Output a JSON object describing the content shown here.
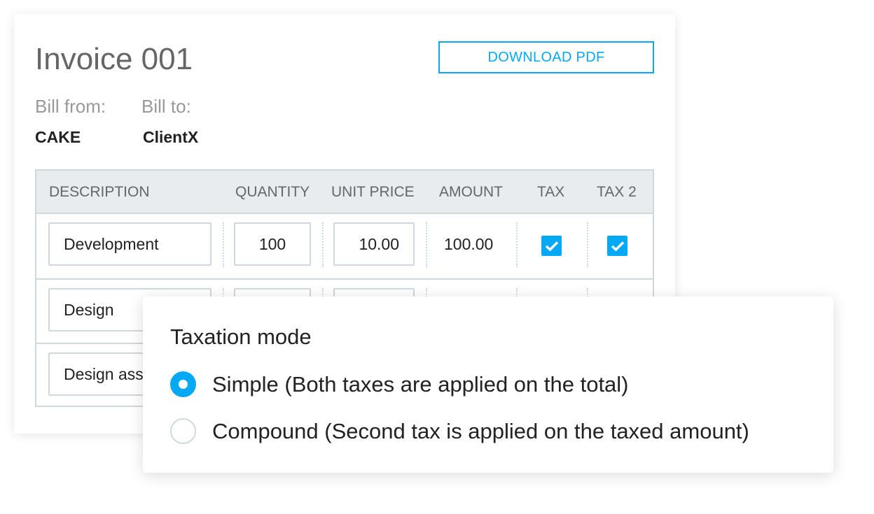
{
  "invoice": {
    "title": "Invoice 001",
    "download_label": "DOWNLOAD PDF",
    "bill_from_label": "Bill from:",
    "bill_from_value": "CAKE",
    "bill_to_label": "Bill to:",
    "bill_to_value": "ClientX"
  },
  "table": {
    "headers": [
      "DESCRIPTION",
      "QUANTITY",
      "UNIT PRICE",
      "AMOUNT",
      "TAX",
      "TAX 2"
    ],
    "rows": [
      {
        "description": "Development",
        "quantity": "100",
        "unit_price": "10.00",
        "amount": "100.00",
        "tax": true,
        "tax2": true
      },
      {
        "description": "Design",
        "quantity": "",
        "unit_price": "",
        "amount": "",
        "tax": null,
        "tax2": null
      },
      {
        "description": "Design ass",
        "quantity": "",
        "unit_price": "",
        "amount": "",
        "tax": null,
        "tax2": null
      }
    ]
  },
  "taxation_popup": {
    "title": "Taxation mode",
    "options": [
      {
        "label": "Simple (Both taxes are applied on the total)",
        "selected": true
      },
      {
        "label": "Compound (Second tax is applied on the taxed amount)",
        "selected": false
      }
    ]
  },
  "colors": {
    "accent": "#03a9f4",
    "border": "#cfd8dc",
    "header_bg": "#e8ecef"
  },
  "icons": {
    "checkbox": "check-icon"
  }
}
